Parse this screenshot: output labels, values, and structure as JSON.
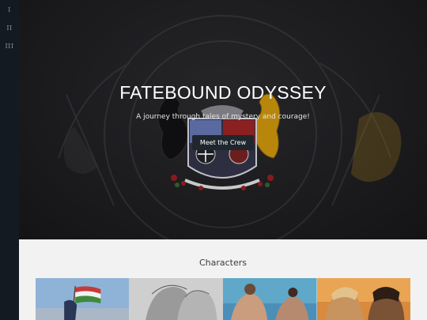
{
  "sidebar": {
    "items": [
      {
        "label": "I",
        "active": true
      },
      {
        "label": "II",
        "active": false
      },
      {
        "label": "III",
        "active": false
      }
    ]
  },
  "hero": {
    "title": "FATEBOUND ODYSSEY",
    "subtitle": "A journey through tales of mystery and courage!",
    "cta_label": "Meet the Crew"
  },
  "characters": {
    "title": "Characters",
    "cards": [
      {
        "name": "card-flag-bearer"
      },
      {
        "name": "card-sketch-portrait"
      },
      {
        "name": "card-sea-warriors"
      },
      {
        "name": "card-sunset-duo"
      }
    ]
  },
  "colors": {
    "sidebar_bg": "#131a22",
    "active_nav": "#4fa3d8",
    "hero_bg": "#1c1c1f",
    "section_bg": "#f2f2f2"
  }
}
